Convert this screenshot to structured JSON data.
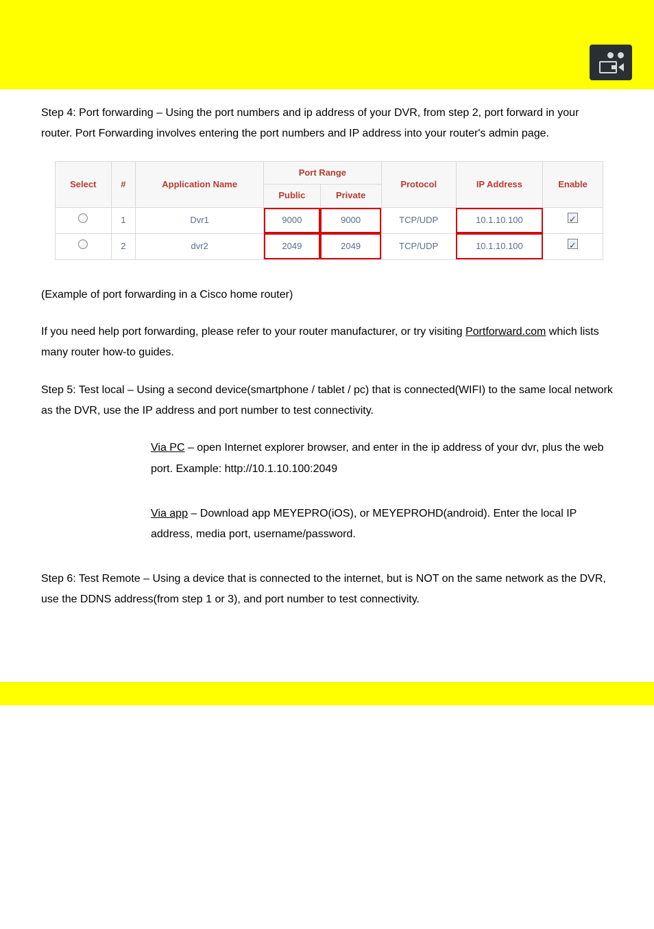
{
  "step4_heading": "Step 4:  Port forwarding ",
  "step4_dash": "–",
  "step4_body": "Using the port numbers and ip address of your DVR, from step 2, port forward in your router.  Port Forwarding involves entering the port numbers and IP address into your router's admin page.",
  "table": {
    "headers": {
      "select": "Select",
      "hash": "#",
      "app": "Application Name",
      "range": "Port Range",
      "public": "Public",
      "private": "Private",
      "protocol": "Protocol",
      "ip": "IP Address",
      "enable": "Enable"
    },
    "rows": [
      {
        "idx": "1",
        "app": "Dvr1",
        "pub": "9000",
        "priv": "9000",
        "proto": "TCP/UDP",
        "ip": "10.1.10.100"
      },
      {
        "idx": "2",
        "app": "dvr2",
        "pub": "2049",
        "priv": "2049",
        "proto": "TCP/UDP",
        "ip": "10.1.10.100"
      }
    ]
  },
  "example_line": "(Example of port forwarding in a Cisco home router)",
  "help_line1": "If you need help port forwarding, please refer to your router manufacturer, or try visiting ",
  "help_link": "Portforward.com",
  "help_line2": " which lists many router how-to guides.",
  "step5_heading": "Step 5:  ",
  "step5_testlocal": "Test local ",
  "step5_dash": "–",
  "step5_body": " Using a second device(smartphone / tablet / pc) that is connected(WIFI) to the same local network as the DVR, use the IP address and port number to test connectivity.",
  "viapc_term": "Via PC",
  "viapc_body": " – open Internet explorer browser, and enter in the ip address of your dvr, plus the web port.  Example:    http://10.1.10.100:2049",
  "viaapp_term": "Via app",
  "viaapp_body": " – Download app MEYEPRO(iOS), or MEYEPROHD(android).  Enter the local IP address, media port, username/password.",
  "step6_heading": "Step 6:  ",
  "step6_term": "Test Remote",
  "step6_body": " – Using a device that is connected to the internet, but is NOT on the same network as the DVR, use the DDNS address(from step 1 or 3), and port number to test connectivity."
}
